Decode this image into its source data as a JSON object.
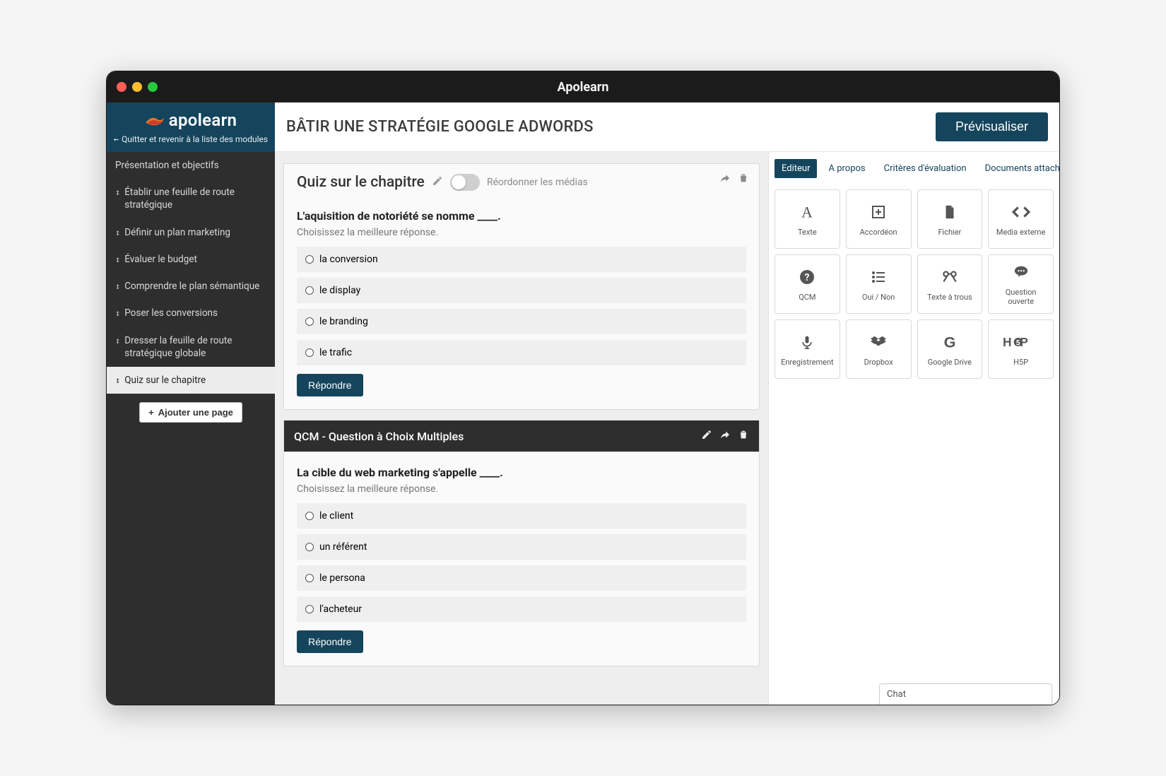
{
  "window": {
    "title": "Apolearn"
  },
  "brand": {
    "name": "apolearn",
    "back_label": "Quitter et revenir à la liste des modules"
  },
  "header": {
    "page_title": "BÂTIR UNE STRATÉGIE GOOGLE ADWORDS",
    "preview_label": "Prévisualiser"
  },
  "sidebar": {
    "items": [
      {
        "label": "Présentation et objectifs",
        "sortable": false
      },
      {
        "label": "Établir une feuille de route stratégique",
        "sortable": true
      },
      {
        "label": "Définir un plan marketing",
        "sortable": true
      },
      {
        "label": "Évaluer le budget",
        "sortable": true
      },
      {
        "label": "Comprendre le plan sémantique",
        "sortable": true
      },
      {
        "label": "Poser les conversions",
        "sortable": true
      },
      {
        "label": "Dresser la feuille de route stratégique globale",
        "sortable": true
      },
      {
        "label": "Quiz sur le chapitre",
        "sortable": true
      }
    ],
    "active_index": 7,
    "add_page_label": "Ajouter une page"
  },
  "content": {
    "quiz_title": "Quiz sur le chapitre",
    "reorder_label": "Réordonner les médias",
    "question1": {
      "title": "L'aquisition de notoriété se nomme ____.",
      "instruction": "Choisissez la meilleure réponse.",
      "options": [
        "la conversion",
        "le display",
        "le branding",
        "le trafic"
      ],
      "answer_btn": "Répondre"
    },
    "question2": {
      "header": "QCM - Question à Choix Multiples",
      "title": "La cible du web marketing s'appelle ____.",
      "instruction": "Choisissez la meilleure réponse.",
      "options": [
        "le client",
        "un référent",
        "le persona",
        "l'acheteur"
      ],
      "answer_btn": "Répondre"
    }
  },
  "panel": {
    "tabs": [
      "Editeur",
      "A propos",
      "Critères d'évaluation",
      "Documents attachés"
    ],
    "active_tab": 0,
    "tools": [
      {
        "id": "text",
        "label": "Texte"
      },
      {
        "id": "accordion",
        "label": "Accordéon"
      },
      {
        "id": "file",
        "label": "Fichier"
      },
      {
        "id": "external-media",
        "label": "Media externe"
      },
      {
        "id": "qcm",
        "label": "QCM"
      },
      {
        "id": "yesno",
        "label": "Oui / Non"
      },
      {
        "id": "fill-blank",
        "label": "Texte à trous"
      },
      {
        "id": "open-question",
        "label": "Question ouverte"
      },
      {
        "id": "recording",
        "label": "Enregistrement"
      },
      {
        "id": "dropbox",
        "label": "Dropbox"
      },
      {
        "id": "google-drive",
        "label": "Google Drive"
      },
      {
        "id": "h5p",
        "label": "H5P"
      }
    ]
  },
  "chat": {
    "label": "Chat"
  }
}
